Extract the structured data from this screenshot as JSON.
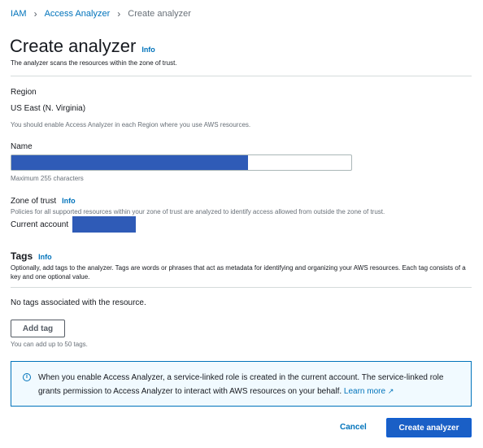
{
  "breadcrumb": {
    "items": [
      "IAM",
      "Access Analyzer"
    ],
    "current": "Create analyzer"
  },
  "header": {
    "title": "Create analyzer",
    "info": "Info",
    "description": "The analyzer scans the resources within the zone of trust."
  },
  "region": {
    "label": "Region",
    "value": "US East (N. Virginia)",
    "hint": "You should enable Access Analyzer in each Region where you use AWS resources."
  },
  "name": {
    "label": "Name",
    "value": "",
    "hint": "Maximum 255 characters"
  },
  "zone": {
    "label": "Zone of trust",
    "info": "Info",
    "hint": "Policies for all supported resources within your zone of trust are analyzed to identify access allowed from outside the zone of trust.",
    "account_label": "Current account"
  },
  "tags": {
    "title": "Tags",
    "info": "Info",
    "description": "Optionally, add tags to the analyzer. Tags are words or phrases that act as metadata for identifying and organizing your AWS resources. Each tag consists of a key and one optional value.",
    "empty": "No tags associated with the resource.",
    "add_label": "Add tag",
    "limit": "You can add up to 50 tags."
  },
  "alert": {
    "text": "When you enable Access Analyzer, a service-linked role is created in the current account. The service-linked role grants permission to Access Analyzer to interact with AWS resources on your behalf.",
    "link": "Learn more",
    "icon": "info-icon"
  },
  "footer": {
    "cancel": "Cancel",
    "create": "Create analyzer"
  },
  "colors": {
    "accent": "#0073bb",
    "primary_button": "#1a5fc6",
    "redaction": "#2f5bb7"
  }
}
